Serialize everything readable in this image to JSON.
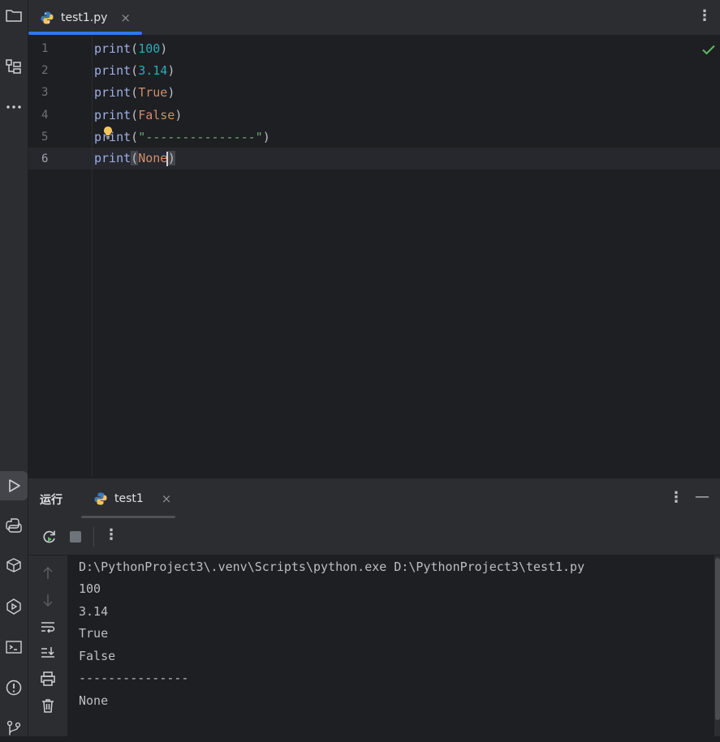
{
  "editor_tab": {
    "filename": "test1.py",
    "close": "×"
  },
  "code_lines": [
    {
      "number": "1",
      "fn": "print",
      "open": "(",
      "arg": "100",
      "close": ")"
    },
    {
      "number": "2",
      "fn": "print",
      "open": "(",
      "arg": "3.14",
      "close": ")"
    },
    {
      "number": "3",
      "fn": "print",
      "open": "(",
      "arg": "True",
      "close": ")"
    },
    {
      "number": "4",
      "fn": "print",
      "open": "(",
      "arg": "False",
      "close": ")"
    },
    {
      "number": "5",
      "fn": "print",
      "open": "(",
      "arg": "\"---------------\"",
      "close": ")"
    },
    {
      "number": "6",
      "fn": "print",
      "open": "(",
      "arg": "None",
      "close": ")"
    }
  ],
  "run_panel": {
    "title": "运行",
    "tab_label": "test1",
    "close": "×"
  },
  "kebab_glyph": "⋮",
  "minimize_glyph": "—",
  "console_output": [
    "D:\\PythonProject3\\.venv\\Scripts\\python.exe D:\\PythonProject3\\test1.py",
    "100",
    "3.14",
    "True",
    "False",
    "---------------",
    "None"
  ],
  "icons": {
    "left_stripe": [
      "folder-icon",
      "structure-icon",
      "more-icon",
      "run-icon",
      "python-console-icon",
      "python-packages-icon",
      "services-icon",
      "terminal-icon",
      "problems-icon",
      "git-icon"
    ],
    "run_toolbar": [
      "rerun-icon",
      "stop-icon",
      "more-icon"
    ],
    "console_side": [
      "scroll-up-icon",
      "scroll-down-icon",
      "soft-wrap-icon",
      "scroll-to-end-icon",
      "print-icon",
      "clear-icon"
    ]
  },
  "colors": {
    "accent": "#3574f0",
    "function": "#9eaee6",
    "number": "#2aacb8",
    "keyword": "#cf8e6d",
    "string": "#6aab73",
    "check": "#5fb865",
    "bulb": "#f2c55c"
  }
}
